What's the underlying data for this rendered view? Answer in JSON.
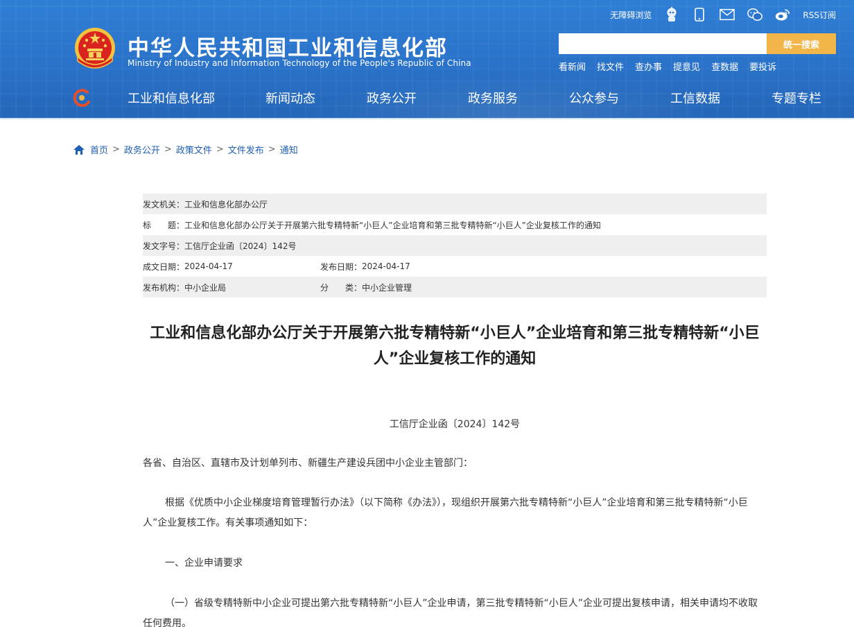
{
  "header": {
    "site_title_cn": "中华人民共和国工业和信息化部",
    "site_title_en": "Ministry of Industry and Information Technology of the People's Republic of China",
    "accessibility_label": "无障碍浏览",
    "rss_label": "RSS订阅",
    "search": {
      "placeholder": "",
      "button_label": "统一搜索"
    },
    "quick_links": [
      "看新闻",
      "找文件",
      "查办事",
      "提意见",
      "查数据",
      "要投诉"
    ],
    "nav": [
      "工业和信息化部",
      "新闻动态",
      "政务公开",
      "政务服务",
      "公众参与",
      "工信数据",
      "专题专栏"
    ],
    "colors": {
      "header_blue": "#2a72c9",
      "search_button": "#f2b54a",
      "link_blue": "#1f5fb0"
    }
  },
  "breadcrumb": [
    "首页",
    "政务公开",
    "政策文件",
    "文件发布",
    "通知"
  ],
  "meta": {
    "issuer_label": "发文机关：",
    "issuer": "工业和信息化部办公厅",
    "title_label": "标　　题：",
    "title": "工业和信息化部办公厅关于开展第六批专精特新“小巨人”企业培育和第三批专精特新“小巨人”企业复核工作的通知",
    "doc_no_label": "发文字号：",
    "doc_no": "工信厅企业函〔2024〕142号",
    "created_label": "成文日期：",
    "created": "2024-04-17",
    "published_label": "发布日期：",
    "published": "2024-04-17",
    "org_label": "发布机构：",
    "org": "中小企业局",
    "category_label": "分　　类：",
    "category": "中小企业管理"
  },
  "article": {
    "title": "工业和信息化部办公厅关于开展第六批专精特新“小巨人”企业培育和第三批专精特新“小巨人”企业复核工作的通知",
    "doc_number": "工信厅企业函〔2024〕142号",
    "salutation": "各省、自治区、直辖市及计划单列市、新疆生产建设兵团中小企业主管部门：",
    "para1": "根据《优质中小企业梯度培育管理暂行办法》（以下简称《办法》），现组织开展第六批专精特新“小巨人”企业培育和第三批专精特新“小巨人”企业复核工作。有关事项通知如下：",
    "section1": "一、企业申请要求",
    "para2": "（一）省级专精特新中小企业可提出第六批专精特新“小巨人”企业申请，第三批专精特新“小巨人”企业可提出复核申请，相关申请均不收取任何费用。"
  }
}
